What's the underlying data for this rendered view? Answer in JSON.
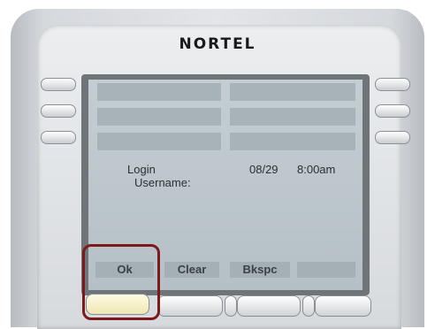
{
  "phone": {
    "brand": "NORTEL",
    "colors": {
      "led_left": "#1f7fe0",
      "led_right": "#e0204f",
      "screen": "#bcc6cb",
      "highlight": "#7a1a1a"
    }
  },
  "screen": {
    "line1_left": "Login",
    "line2_left": "Username:",
    "date": "08/29",
    "time": "8:00am"
  },
  "softkeys": [
    "Ok",
    "Clear",
    "Bkspc",
    ""
  ]
}
